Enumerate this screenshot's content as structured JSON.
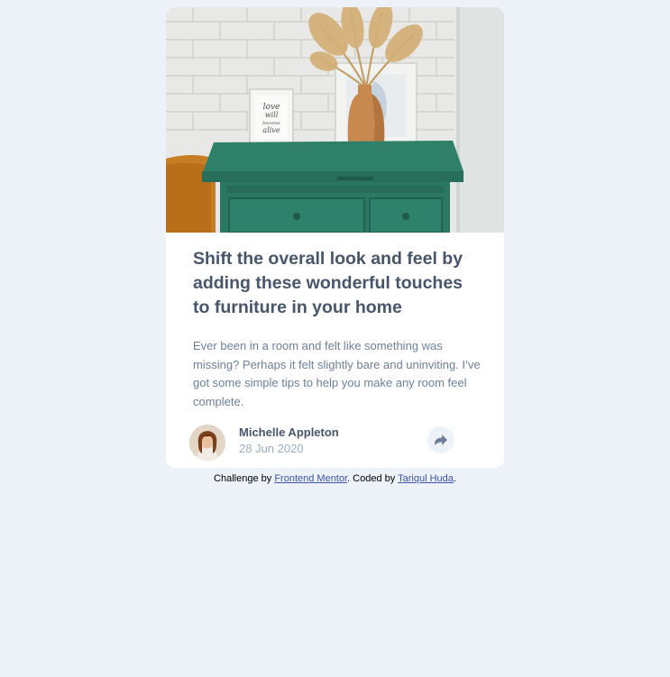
{
  "card": {
    "image_alt": "drawers",
    "frame_text": "love will become alive",
    "title": "Shift the overall look and feel by adding these wonderful touches to furniture in your home",
    "description": "Ever been in a room and felt like something was missing? Perhaps it felt slightly bare and uninviting. I’ve got some simple tips to help you make any room feel complete.",
    "author": {
      "name": "Michelle Appleton",
      "date": "28 Jun 2020"
    },
    "share_icon": "share-icon"
  },
  "attribution": {
    "prefix": "Challenge by ",
    "link1": "Frontend Mentor",
    "middle": ". Coded by ",
    "link2": "Tariqul Huda",
    "suffix": "."
  },
  "colors": {
    "page_bg": "#ecf2f8",
    "heading": "#48556a",
    "body_text": "#6e8098",
    "muted": "#9eafc2",
    "link": "#3e52a3"
  }
}
